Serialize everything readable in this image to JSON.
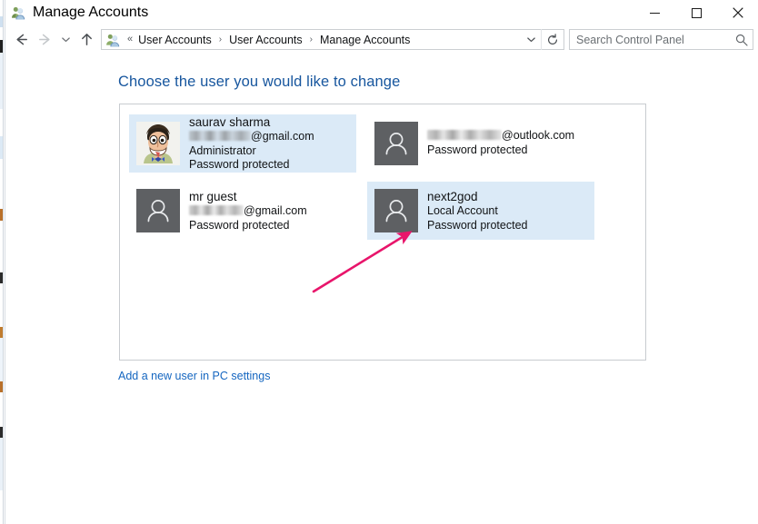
{
  "window": {
    "title": "Manage Accounts",
    "icon": "user-accounts-icon",
    "controls": {
      "minimize": "—",
      "maximize": "□",
      "close": "✕"
    }
  },
  "navbar": {
    "back_label": "←",
    "forward_label": "→",
    "recent_label": "⌄",
    "up_label": "↑",
    "breadcrumb_icon": "user-accounts-icon",
    "breadcrumb_overflow": "«",
    "breadcrumb": [
      "User Accounts",
      "User Accounts",
      "Manage Accounts"
    ],
    "breadcrumb_separator": "›",
    "dropdown_label": "⌄",
    "refresh_label": "↻"
  },
  "search": {
    "placeholder": "Search Control Panel",
    "value": "",
    "icon": "search-icon"
  },
  "main": {
    "heading": "Choose the user you would like to change",
    "add_user_link": "Add a new user in PC settings",
    "accounts": [
      {
        "name": "saurav sharma",
        "email_redacted": true,
        "email_redacted_width": 68,
        "email_domain": "@gmail.com",
        "account_type": "Administrator",
        "password_status": "Password protected",
        "avatar": "cartoon-face-photo",
        "selected": true
      },
      {
        "name": "",
        "email_redacted": true,
        "email_redacted_width": 82,
        "email_domain": "@outlook.com",
        "account_type": "",
        "password_status": "Password protected",
        "avatar": "default-person-icon",
        "selected": false
      },
      {
        "name": "mr guest",
        "email_redacted": true,
        "email_redacted_width": 60,
        "email_domain": "@gmail.com",
        "account_type": "",
        "password_status": "Password protected",
        "avatar": "default-person-icon",
        "selected": false
      },
      {
        "name": "next2god",
        "email_redacted": false,
        "email_redacted_width": 0,
        "email_domain": "",
        "account_type": "Local Account",
        "password_status": "Password protected",
        "avatar": "default-person-icon",
        "selected": true
      }
    ]
  },
  "annotation": {
    "type": "arrow",
    "color": "#E8156B",
    "points_to": "next2god-account-tile"
  },
  "colors": {
    "heading_blue": "#17569e",
    "link_blue": "#1566c0",
    "tile_selected": "#dbeaf7",
    "avatar_gray": "#5e6063",
    "panel_border": "#c8ccd0",
    "annotation_pink": "#E8156B"
  }
}
